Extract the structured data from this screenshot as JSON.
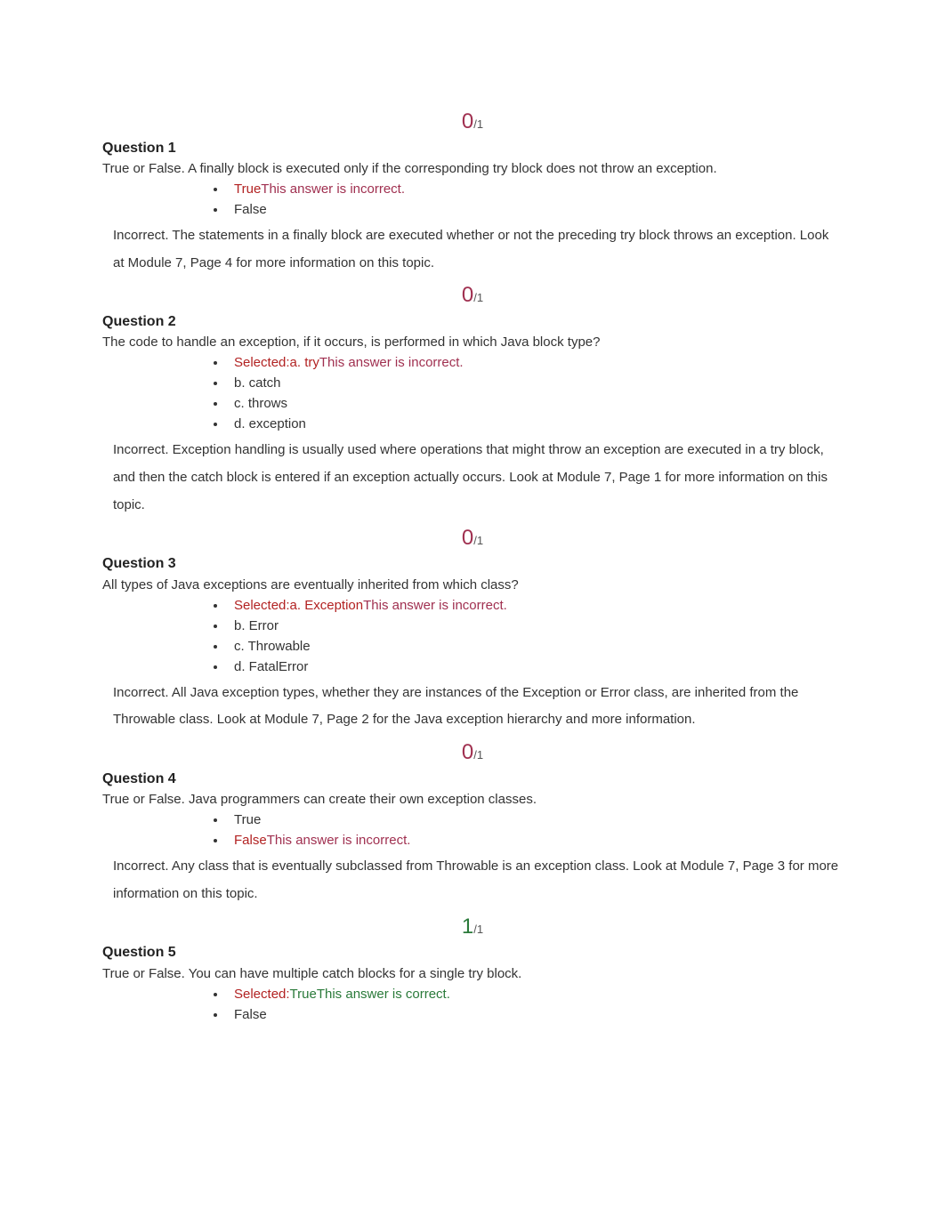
{
  "questions": [
    {
      "score_earned": "0",
      "score_total": "/1",
      "score_class": "incorrect",
      "title": "Question 1",
      "prompt": "True or False. A finally block is executed only if the corresponding try block does not throw an exception.",
      "options": [
        {
          "prefix": "",
          "answer": "True",
          "answer_class": "sel-answer",
          "verdict": "This answer is incorrect.",
          "verdict_class": "verdict",
          "plain": ""
        },
        {
          "prefix": "",
          "answer": "",
          "answer_class": "",
          "verdict": "",
          "verdict_class": "",
          "plain": "False"
        }
      ],
      "feedback": "Incorrect. The statements in a finally block are executed whether or not the preceding try block throws an exception. Look at Module 7, Page 4 for more information on this topic."
    },
    {
      "score_earned": "0",
      "score_total": "/1",
      "score_class": "incorrect",
      "title": "Question 2",
      "prompt": "The code to handle an exception, if it occurs, is performed in which Java block type?",
      "options": [
        {
          "prefix": "Selected:",
          "answer": "a. try",
          "answer_class": "sel-answer",
          "verdict": "This answer is incorrect.",
          "verdict_class": "verdict",
          "plain": ""
        },
        {
          "prefix": "",
          "answer": "",
          "answer_class": "",
          "verdict": "",
          "verdict_class": "",
          "plain": "b. catch"
        },
        {
          "prefix": "",
          "answer": "",
          "answer_class": "",
          "verdict": "",
          "verdict_class": "",
          "plain": "c. throws"
        },
        {
          "prefix": "",
          "answer": "",
          "answer_class": "",
          "verdict": "",
          "verdict_class": "",
          "plain": "d. exception"
        }
      ],
      "feedback": "Incorrect. Exception handling is usually used where operations that might throw an exception are executed in a try block, and then the catch block is entered if an exception actually occurs. Look at Module 7, Page 1 for more information on this topic."
    },
    {
      "score_earned": "0",
      "score_total": "/1",
      "score_class": "incorrect",
      "title": "Question 3",
      "prompt": "All types of Java exceptions are eventually inherited from which class?",
      "options": [
        {
          "prefix": "Selected:",
          "answer": "a. Exception",
          "answer_class": "sel-answer",
          "verdict": "This answer is incorrect.",
          "verdict_class": "verdict",
          "plain": ""
        },
        {
          "prefix": "",
          "answer": "",
          "answer_class": "",
          "verdict": "",
          "verdict_class": "",
          "plain": "b. Error"
        },
        {
          "prefix": "",
          "answer": "",
          "answer_class": "",
          "verdict": "",
          "verdict_class": "",
          "plain": "c. Throwable"
        },
        {
          "prefix": "",
          "answer": "",
          "answer_class": "",
          "verdict": "",
          "verdict_class": "",
          "plain": "d. FatalError"
        }
      ],
      "feedback": "Incorrect. All Java exception types, whether they are instances of the Exception or Error class, are inherited from the Throwable class. Look at Module 7, Page 2 for the Java exception hierarchy and more information."
    },
    {
      "score_earned": "0",
      "score_total": "/1",
      "score_class": "incorrect",
      "title": "Question 4",
      "prompt": "True or False. Java programmers can create their own exception classes.",
      "options": [
        {
          "prefix": "",
          "answer": "",
          "answer_class": "",
          "verdict": "",
          "verdict_class": "",
          "plain": "True"
        },
        {
          "prefix": "",
          "answer": "False",
          "answer_class": "sel-answer",
          "verdict": "This answer is incorrect.",
          "verdict_class": "verdict",
          "plain": ""
        }
      ],
      "feedback": "Incorrect. Any class that is eventually subclassed from Throwable is an exception class. Look at Module 7, Page 3 for more information on this topic."
    },
    {
      "score_earned": "1",
      "score_total": "/1",
      "score_class": "correct",
      "title": "Question 5",
      "prompt": "True or False. You can have multiple catch blocks for a single try block.",
      "options": [
        {
          "prefix": "Selected:",
          "answer": "True",
          "answer_class": "sel-answer green",
          "verdict": "This answer is correct.",
          "verdict_class": "verdict green",
          "plain": ""
        },
        {
          "prefix": "",
          "answer": "",
          "answer_class": "",
          "verdict": "",
          "verdict_class": "",
          "plain": "False"
        }
      ],
      "feedback": ""
    }
  ]
}
